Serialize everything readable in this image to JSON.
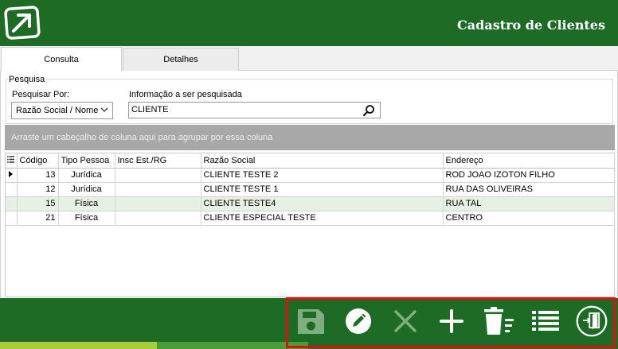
{
  "header": {
    "title": "Cadastro de Clientes",
    "logo_icon": "arrow-up-right-logo-icon"
  },
  "tabs": [
    {
      "label": "Consulta",
      "active": true
    },
    {
      "label": "Detalhes",
      "active": false
    }
  ],
  "search": {
    "group_title": "Pesquisa",
    "field_label": "Pesquisar Por:",
    "field_value": "Razão Social / Nome",
    "query_label": "Informação a ser pesquisada",
    "query_value": "CLIENTE"
  },
  "grid": {
    "group_by_hint": "Arraste um cabeçalho de coluna aqui para agrupar por essa coluna",
    "columns": [
      "Código",
      "Tipo Pessoa",
      "Insc Est./RG",
      "Razão Social",
      "Endereço"
    ],
    "rows": [
      {
        "codigo": "13",
        "tipo": "Jurídica",
        "insc": "",
        "razao": "CLIENTE TESTE 2",
        "endereco": "ROD JOAO IZOTON FILHO"
      },
      {
        "codigo": "12",
        "tipo": "Jurídica",
        "insc": "",
        "razao": "CLIENTE TESTE 1",
        "endereco": "RUA DAS OLIVEIRAS"
      },
      {
        "codigo": "15",
        "tipo": "Física",
        "insc": "",
        "razao": "CLIENTE TESTE4",
        "endereco": "RUA TAL"
      },
      {
        "codigo": "21",
        "tipo": "Física",
        "insc": "",
        "razao": "CLIENTE ESPECIAL TESTE",
        "endereco": "CENTRO"
      }
    ]
  },
  "toolbar": {
    "icons": [
      "save-icon",
      "edit-icon",
      "cancel-icon",
      "add-icon",
      "delete-icon",
      "list-icon",
      "exit-icon"
    ]
  },
  "colors": {
    "header_bg": "#1e6b25",
    "alt_row": "#e6f1e3",
    "highlight": "#e01010"
  }
}
